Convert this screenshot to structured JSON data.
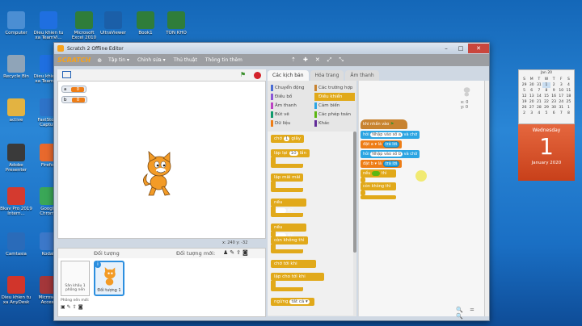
{
  "desktop": {
    "icons": [
      {
        "label": "Computer",
        "color": "#4b8ed3"
      },
      {
        "label": "Dieu khien tu xa TeamVi...",
        "color": "#1f6fe0"
      },
      {
        "label": "Microsoft Excel 2010",
        "color": "#2f7d3a"
      },
      {
        "label": "UltraViewer",
        "color": "#1b5fa8"
      },
      {
        "label": "Book1",
        "color": "#2f7d3a"
      },
      {
        "label": "TON KHO",
        "color": "#2f7d3a"
      },
      {
        "label": "Recycle Bin",
        "color": "#8fa4b8"
      },
      {
        "label": "Dieu khien tu xa TeamVi...",
        "color": "#1f6fe0"
      },
      {
        "label": "active",
        "color": "#e3b341"
      },
      {
        "label": "FastStone Capture",
        "color": "#2e73c8"
      },
      {
        "label": "Adobe Presenter",
        "color": "#3a3a3a"
      },
      {
        "label": "Firefox",
        "color": "#e8692d"
      },
      {
        "label": "Bkav Pro 2019 Intern...",
        "color": "#d43a2f"
      },
      {
        "label": "Google Chrome",
        "color": "#3aa757"
      },
      {
        "label": "Camtasia",
        "color": "#2a6bb9"
      },
      {
        "label": "Kodak",
        "color": "#3c78c9"
      },
      {
        "label": "Dieu khien tu xa AnyDesk",
        "color": "#d1352b"
      },
      {
        "label": "Microsoft Access",
        "color": "#a4373a"
      }
    ]
  },
  "window": {
    "title": "Scratch 2 Offline Editor",
    "controls": {
      "minimize": "–",
      "maximize": "□",
      "close": "✕"
    }
  },
  "menubar": {
    "logo": "SCRATCH",
    "menus": [
      "Tập tin ▾",
      "Chỉnh sửa ▾",
      "Thủ thuật",
      "Thông tin thêm"
    ],
    "tools": [
      "⇡",
      "✚",
      "✕",
      "⤢",
      "⤡"
    ]
  },
  "stage": {
    "monitors": [
      {
        "name": "a",
        "value": "0"
      },
      {
        "name": "b",
        "value": "0"
      }
    ],
    "coords": "x: 240  y: -32"
  },
  "sprites_panel": {
    "title": "Đối tượng",
    "new_sprite": "Đối tượng mới:",
    "stage_label": "Sân khấu 1 phông nền",
    "new_backdrop": "Phông nền mới:",
    "sprite_name": "Đối tượng 1",
    "info_icon": "i"
  },
  "tabs": [
    "Các kịch bản",
    "Hóa trang",
    "Âm thanh"
  ],
  "categories": [
    {
      "label": "Chuyển động",
      "color": "#4a6cd4"
    },
    {
      "label": "Các trường hợp",
      "color": "#c88330"
    },
    {
      "label": "Điều bố",
      "color": "#8a55d7"
    },
    {
      "label": "Điều khiển",
      "color": "#e1a91a",
      "selected": true
    },
    {
      "label": "Âm thanh",
      "color": "#bb42c3"
    },
    {
      "label": "Cảm biến",
      "color": "#2ca5e2"
    },
    {
      "label": "Bút vẽ",
      "color": "#0e9a6c"
    },
    {
      "label": "Các phép toán",
      "color": "#5cb712"
    },
    {
      "label": "Dữ liệu",
      "color": "#ee7d16"
    },
    {
      "label": "Khác",
      "color": "#632d99"
    }
  ],
  "palette_blocks": [
    {
      "text": "chờ",
      "num": "1",
      "suffix": "giây"
    },
    {
      "text": "lặp lại",
      "num": "10",
      "suffix": "lần"
    },
    {
      "text": "lặp mãi mãi",
      "num": "",
      "suffix": ""
    },
    {
      "text": "nếu",
      "num": "",
      "suffix": "thì"
    },
    {
      "text": "nếu",
      "num": "",
      "suffix": "thì"
    },
    {
      "text": "còn không thì",
      "num": "",
      "suffix": ""
    },
    {
      "text": "chờ tới khi",
      "num": "",
      "suffix": ""
    },
    {
      "text": "lặp cho tới khi",
      "num": "",
      "suffix": ""
    },
    {
      "text": "ngừng",
      "num": "tất cả ▾",
      "suffix": ""
    }
  ],
  "script": {
    "hat": "khi nhấn vào",
    "hat_flag": "⚑",
    "ask1": {
      "pre": "hỏi",
      "input": "Nhập vào số a",
      "post": "và chờ"
    },
    "set1": {
      "pre": "đặt",
      "var": "a ▾",
      "mid": "là",
      "rep": "trả lời"
    },
    "ask2": {
      "pre": "hỏi",
      "input": "Nhập vào số b",
      "post": "và chờ"
    },
    "set2": {
      "pre": "đặt",
      "var": "b ▾",
      "mid": "là",
      "rep": "trả lời"
    },
    "if_text": "nếu",
    "if_then": "thì",
    "else_text": "còn không thì",
    "sprite_pos": "x: 0\ny: 0"
  },
  "zoom_controls": "🔍 = 🔍",
  "calendar": {
    "month": "Jan 20",
    "weekdays": [
      "S",
      "M",
      "T",
      "W",
      "T",
      "F",
      "S"
    ],
    "days": [
      "29",
      "30",
      "31",
      "1",
      "2",
      "3",
      "4",
      "5",
      "6",
      "7",
      "8",
      "9",
      "10",
      "11",
      "12",
      "13",
      "14",
      "15",
      "16",
      "17",
      "18",
      "19",
      "20",
      "21",
      "22",
      "23",
      "24",
      "25",
      "26",
      "27",
      "28",
      "29",
      "30",
      "31",
      "1",
      "2",
      "3",
      "4",
      "5",
      "6",
      "7",
      "8"
    ],
    "today_index": 3,
    "weekday": "Wednesday",
    "day": "1",
    "month_year": "January 2020"
  }
}
